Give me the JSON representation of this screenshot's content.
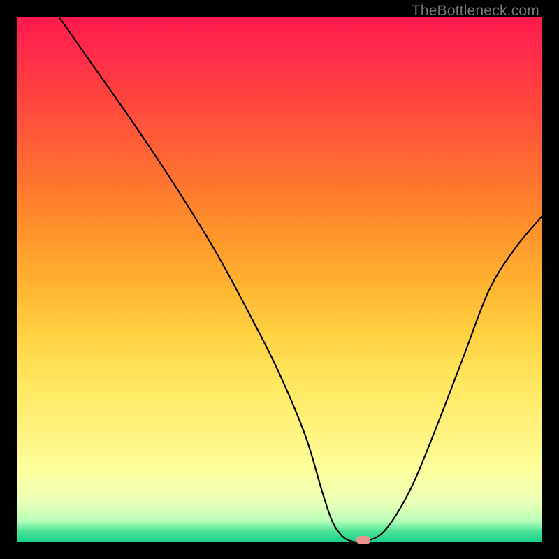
{
  "watermark": "TheBottleneck.com",
  "chart_data": {
    "type": "line",
    "title": "",
    "xlabel": "",
    "ylabel": "",
    "xlim": [
      0,
      100
    ],
    "ylim": [
      0,
      100
    ],
    "grid": false,
    "x": [
      8,
      15,
      22,
      30,
      38,
      45,
      50,
      55,
      58,
      60,
      62,
      64,
      66,
      70,
      75,
      80,
      85,
      90,
      95,
      100
    ],
    "values": [
      100,
      90,
      80,
      68,
      55,
      42,
      32,
      20,
      10,
      4,
      1,
      0,
      0,
      2,
      10,
      22,
      35,
      48,
      56,
      62
    ],
    "marker": {
      "x": 66,
      "y": 0
    },
    "gradient_stops": [
      {
        "pos": 0,
        "color": "#ff1a4d"
      },
      {
        "pos": 28,
        "color": "#ff6a33"
      },
      {
        "pos": 60,
        "color": "#ffd040"
      },
      {
        "pos": 86,
        "color": "#fcff9c"
      },
      {
        "pos": 100,
        "color": "#18d28a"
      }
    ]
  }
}
